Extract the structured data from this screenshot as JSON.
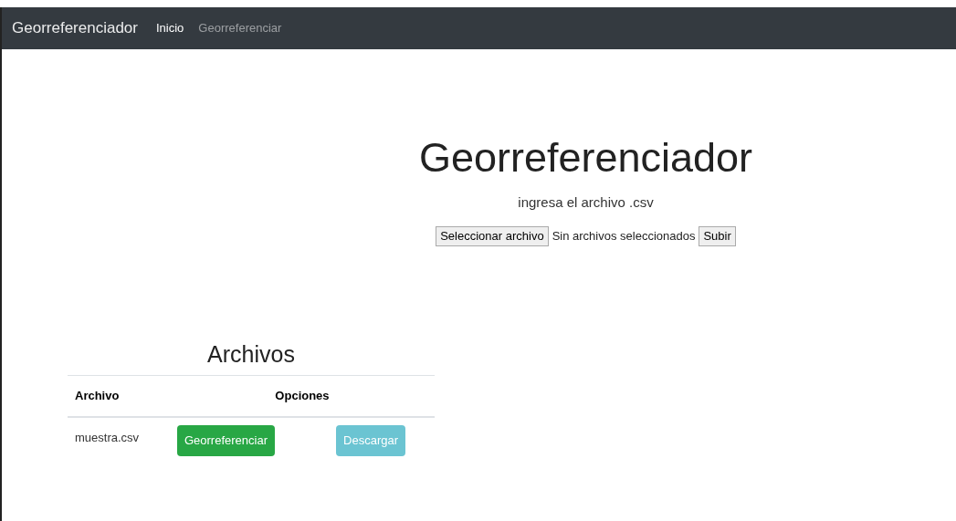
{
  "navbar": {
    "brand": "Georreferenciador",
    "links": [
      {
        "label": "Inicio",
        "selected": true
      },
      {
        "label": "Georreferenciar",
        "selected": false
      }
    ]
  },
  "hero": {
    "title": "Georreferenciador",
    "subtitle": "ingresa el archivo .csv",
    "file_button": "Seleccionar archivo",
    "file_status": "Sin archivos seleccionados",
    "submit": "Subir"
  },
  "files": {
    "title": "Archivos",
    "columns": [
      "Archivo",
      "Opciones"
    ],
    "rows": [
      {
        "name": "muestra.csv",
        "actions": [
          {
            "label": "Georreferenciar",
            "kind": "success",
            "disabled": false
          },
          {
            "label": "Descargar",
            "kind": "info",
            "disabled": true
          }
        ]
      }
    ]
  }
}
